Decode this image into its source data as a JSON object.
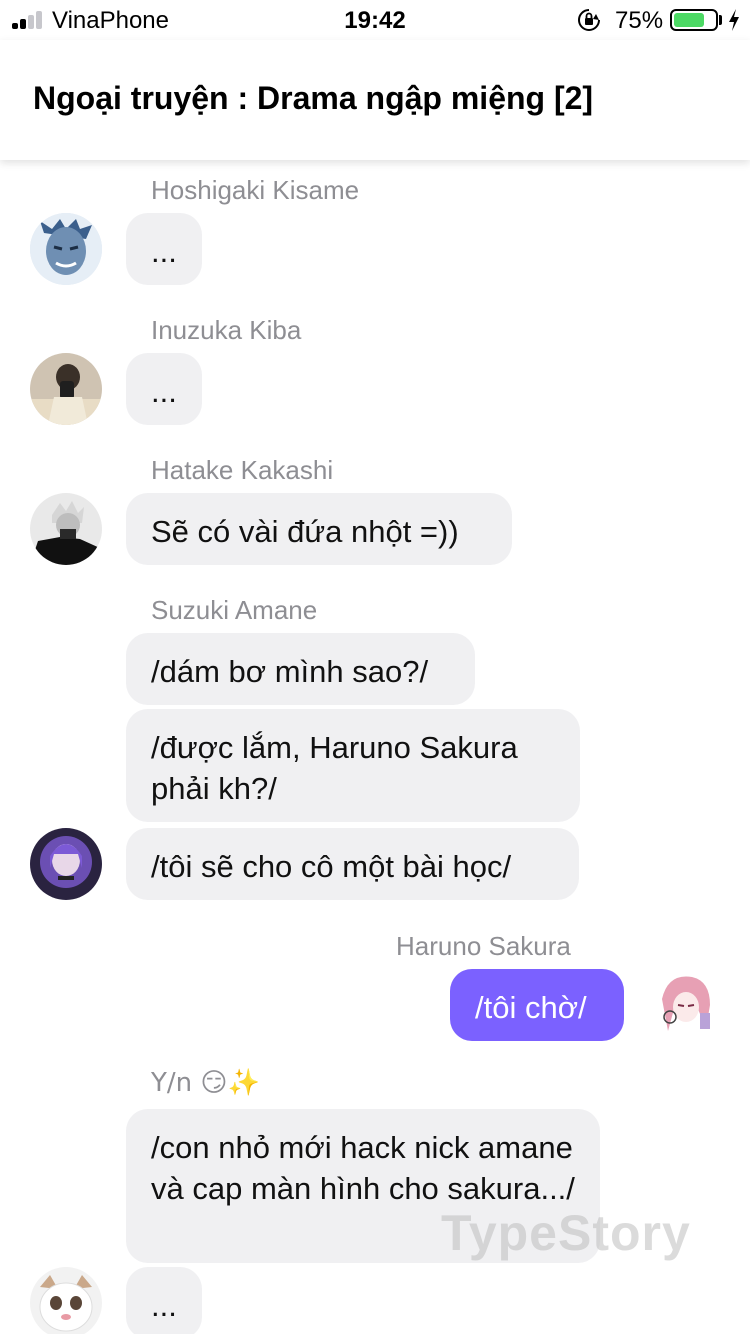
{
  "status_bar": {
    "carrier": "VinaPhone",
    "time": "19:42",
    "battery_percent": "75%",
    "battery_level": 0.75
  },
  "header": {
    "title": "Ngoại truyện : Drama ngập miệng [2]"
  },
  "messages": [
    {
      "sender": "Hoshigaki Kisame",
      "avatar": "kisame-avatar",
      "bubbles": [
        "..."
      ]
    },
    {
      "sender": "Inuzuka Kiba",
      "avatar": "kiba-avatar",
      "bubbles": [
        "..."
      ]
    },
    {
      "sender": "Hatake Kakashi",
      "avatar": "kakashi-avatar",
      "bubbles": [
        "Sẽ có vài đứa nhột =))"
      ]
    },
    {
      "sender": "Suzuki Amane",
      "avatar": "amane-avatar",
      "bubbles": [
        "/dám bơ mình sao?/",
        "/được lắm, Haruno Sakura phải kh?/",
        "/tôi sẽ cho cô một bài học/"
      ]
    },
    {
      "sender": "Haruno Sakura",
      "avatar": "sakura-avatar",
      "is_me": true,
      "bubbles": [
        "/tôi chờ/"
      ]
    },
    {
      "sender": "Y/n 😏✨",
      "avatar": "yn-avatar",
      "bubbles": [
        "/con nhỏ mới hack nick amane và cap màn hình cho sakura.../",
        "..."
      ]
    }
  ],
  "watermark": "TypeStory",
  "colors": {
    "accent": "#7b61ff",
    "bubble_bg": "#f0f0f2",
    "name_gray": "#8e8e93",
    "battery_green": "#4cd964"
  }
}
